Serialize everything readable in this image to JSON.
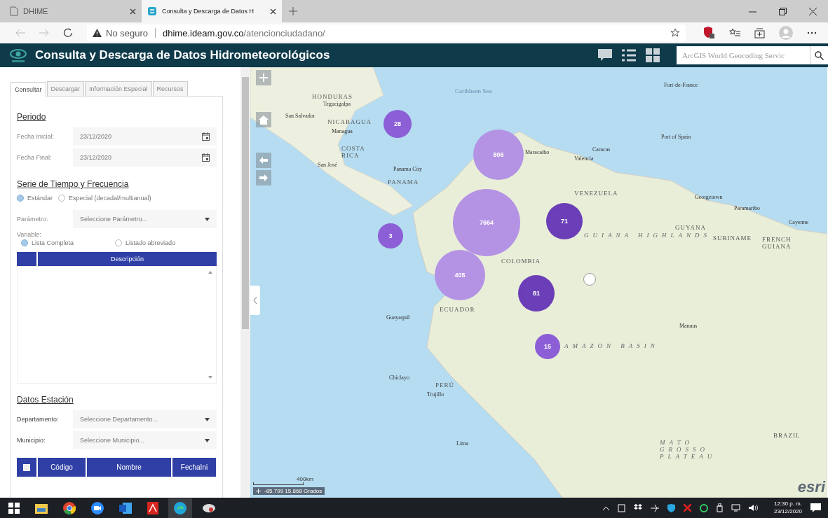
{
  "browser": {
    "tabs": [
      {
        "title": "DHIME",
        "selected": false
      },
      {
        "title": "Consulta y Descarga de Datos H",
        "selected": true
      }
    ],
    "address": {
      "security": "No seguro",
      "host": "dhime.ideam.gov.co",
      "path": "/atencionciudadano/"
    }
  },
  "app": {
    "title": "Consulta y Descarga de Datos Hidrometeorológicos",
    "search": {
      "placeholder": "ArcGIS World Geocoding Servic"
    }
  },
  "panel": {
    "tabs": [
      {
        "label": "Consultar",
        "selected": true
      },
      {
        "label": "Descargar",
        "selected": false
      },
      {
        "label": "Información Especial",
        "selected": false
      },
      {
        "label": "Recursos",
        "selected": false
      }
    ],
    "periodo": {
      "title": "Periodo",
      "fields": [
        {
          "label": "Fecha Inicial:",
          "value": "23/12/2020"
        },
        {
          "label": "Fecha Final:",
          "value": "23/12/2020"
        }
      ]
    },
    "serie": {
      "title": "Serie de Tiempo y Frecuencia",
      "frequency": [
        {
          "label": "Estándar",
          "selected": true
        },
        {
          "label": "Especial (decadal/multianual)",
          "selected": false
        }
      ],
      "parametro": {
        "label": "Parámetro:",
        "placeholder": "Seleccione Parámetro..."
      },
      "variable_label": "Variable:",
      "variable_options": [
        {
          "label": "Lista Completa",
          "selected": true
        },
        {
          "label": "Listado abreviado",
          "selected": false
        }
      ],
      "table": {
        "columns": [
          "Descripción"
        ]
      }
    },
    "estacion": {
      "title": "Datos Estación",
      "dropdowns": [
        {
          "label": "Departamento:",
          "placeholder": "Seleccione Departamento..."
        },
        {
          "label": "Municipio:",
          "placeholder": "Seleccione Municipio..."
        }
      ],
      "table": {
        "select_all_checked": false,
        "columns": [
          "Código",
          "Nombre",
          "FechaIni"
        ]
      }
    }
  },
  "map": {
    "labels": [
      {
        "text": "Caribbean Sea",
        "kind": "water"
      },
      {
        "text": "HONDURAS",
        "kind": "country"
      },
      {
        "text": "Tegucigalpa",
        "kind": "city"
      },
      {
        "text": "San Salvador",
        "kind": "city"
      },
      {
        "text": "NICARAGUA",
        "kind": "country"
      },
      {
        "text": "Managua",
        "kind": "city"
      },
      {
        "text": "COSTA RICA",
        "kind": "country"
      },
      {
        "text": "San José",
        "kind": "city"
      },
      {
        "text": "Panama City",
        "kind": "city"
      },
      {
        "text": "PANAMA",
        "kind": "country"
      },
      {
        "text": "Maracaibo",
        "kind": "city"
      },
      {
        "text": "Caracas",
        "kind": "city"
      },
      {
        "text": "Valencia",
        "kind": "city"
      },
      {
        "text": "Fort-de-France",
        "kind": "city"
      },
      {
        "text": "Port of Spain",
        "kind": "city"
      },
      {
        "text": "VENEZUELA",
        "kind": "country"
      },
      {
        "text": "Georgetown",
        "kind": "city"
      },
      {
        "text": "Paramaribo",
        "kind": "city"
      },
      {
        "text": "Cayenne",
        "kind": "city"
      },
      {
        "text": "GUYANA",
        "kind": "country"
      },
      {
        "text": "SURINAME",
        "kind": "country"
      },
      {
        "text": "FRENCH GUIANA",
        "kind": "country"
      },
      {
        "text": "GUIANA HIGHLANDS",
        "kind": "region"
      },
      {
        "text": "COLOMBIA",
        "kind": "country"
      },
      {
        "text": "ECUADOR",
        "kind": "country"
      },
      {
        "text": "Guayaquil",
        "kind": "city"
      },
      {
        "text": "Manaus",
        "kind": "city"
      },
      {
        "text": "AMAZON BASIN",
        "kind": "region"
      },
      {
        "text": "Chiclayo",
        "kind": "city"
      },
      {
        "text": "PERÚ",
        "kind": "country"
      },
      {
        "text": "Trujillo",
        "kind": "city"
      },
      {
        "text": "Lima",
        "kind": "city"
      },
      {
        "text": "BRAZIL",
        "kind": "country"
      },
      {
        "text": "MATO GROSSO PLATEAU",
        "kind": "region"
      }
    ],
    "clusters": [
      {
        "count": "28",
        "color": "#8c5fd6"
      },
      {
        "count": "806",
        "color": "#b493e4"
      },
      {
        "count": "7664",
        "color": "#b493e4"
      },
      {
        "count": "71",
        "color": "#6b3fb8"
      },
      {
        "count": "3",
        "color": "#8c5fd6"
      },
      {
        "count": "405",
        "color": "#b493e4"
      },
      {
        "count": "81",
        "color": "#6b3fb8"
      },
      {
        "count": "15",
        "color": "#8c5fd6"
      }
    ],
    "scale": "400km",
    "coordinates": "-85.799 15.868 Grados",
    "logo": "esri"
  },
  "taskbar": {
    "time": "12:30 p. m.",
    "date": "23/12/2020"
  }
}
